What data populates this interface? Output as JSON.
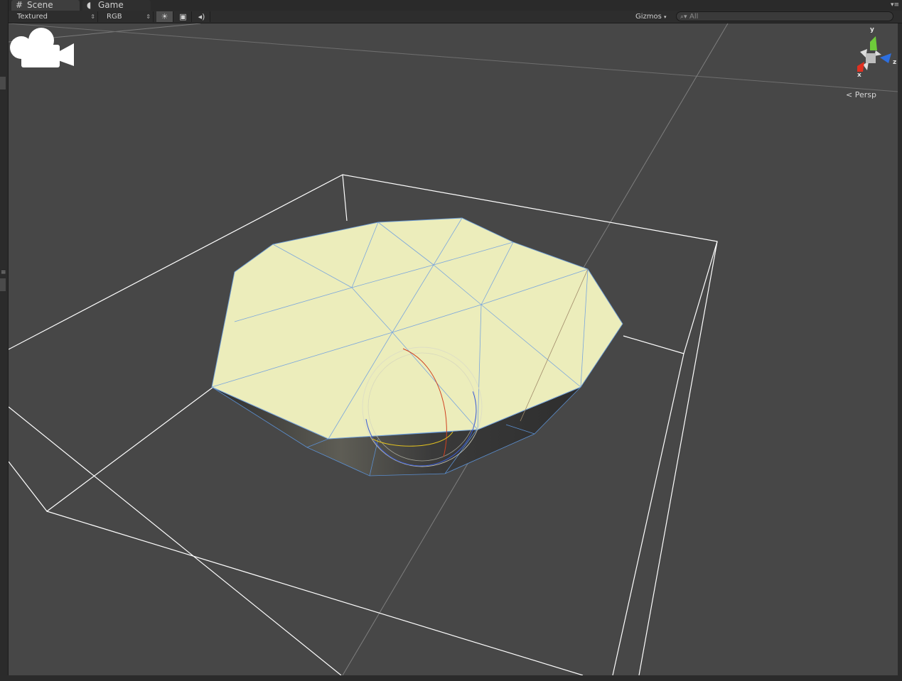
{
  "tabs": [
    {
      "label": "Scene",
      "icon": "grid-icon"
    },
    {
      "label": "Game",
      "icon": "pacman-icon"
    }
  ],
  "toolbar": {
    "render_mode": "Textured",
    "color_mode": "RGB",
    "lighting_toggle": "sun-icon",
    "scene_fx_toggle": "image-icon",
    "audio_toggle": "speaker-icon",
    "gizmos_label": "Gizmos",
    "search_placeholder": "All"
  },
  "viewport": {
    "projection_label": "Persp",
    "axis_labels": {
      "x": "x",
      "y": "y",
      "z": "z"
    },
    "camera_icon": "camera-icon",
    "mesh_fill_color": "#ecedbb",
    "wire_color": "#6b9bd6",
    "background_color": "#474747"
  }
}
